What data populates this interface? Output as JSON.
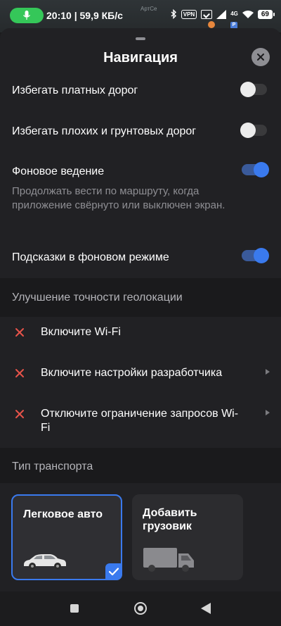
{
  "status_bar": {
    "time_speed": "20:10 | 59,9 КБ/с",
    "vpn": "VPN",
    "network": "4G",
    "battery": "69",
    "map_hint": "АртСе",
    "map_pin": "P"
  },
  "sheet": {
    "title": "Навигация"
  },
  "settings": {
    "avoid_toll": {
      "label": "Избегать платных дорог",
      "enabled": false
    },
    "avoid_bad_roads": {
      "label": "Избегать плохих и грунтовых дорог",
      "enabled": false
    },
    "background_guidance": {
      "label": "Фоновое ведение",
      "description": "Продолжать вести по маршруту, когда приложение свёрнуто или выключен экран.",
      "enabled": true
    },
    "background_hints": {
      "label": "Подсказки в фоновом режиме",
      "enabled": true
    }
  },
  "geolocation": {
    "header": "Улучшение точности геолокации",
    "items": [
      {
        "label": "Включите Wi-Fi"
      },
      {
        "label": "Включите настройки разработчика"
      },
      {
        "label": "Отключите ограничение запросов Wi-Fi"
      }
    ]
  },
  "transport": {
    "header": "Тип транспорта",
    "options": [
      {
        "label": "Легковое авто",
        "selected": true
      },
      {
        "label": "Добавить грузовик",
        "selected": false
      }
    ]
  },
  "colors": {
    "accent": "#3a7aee",
    "error": "#e8534a",
    "sheet_bg": "#212124"
  }
}
